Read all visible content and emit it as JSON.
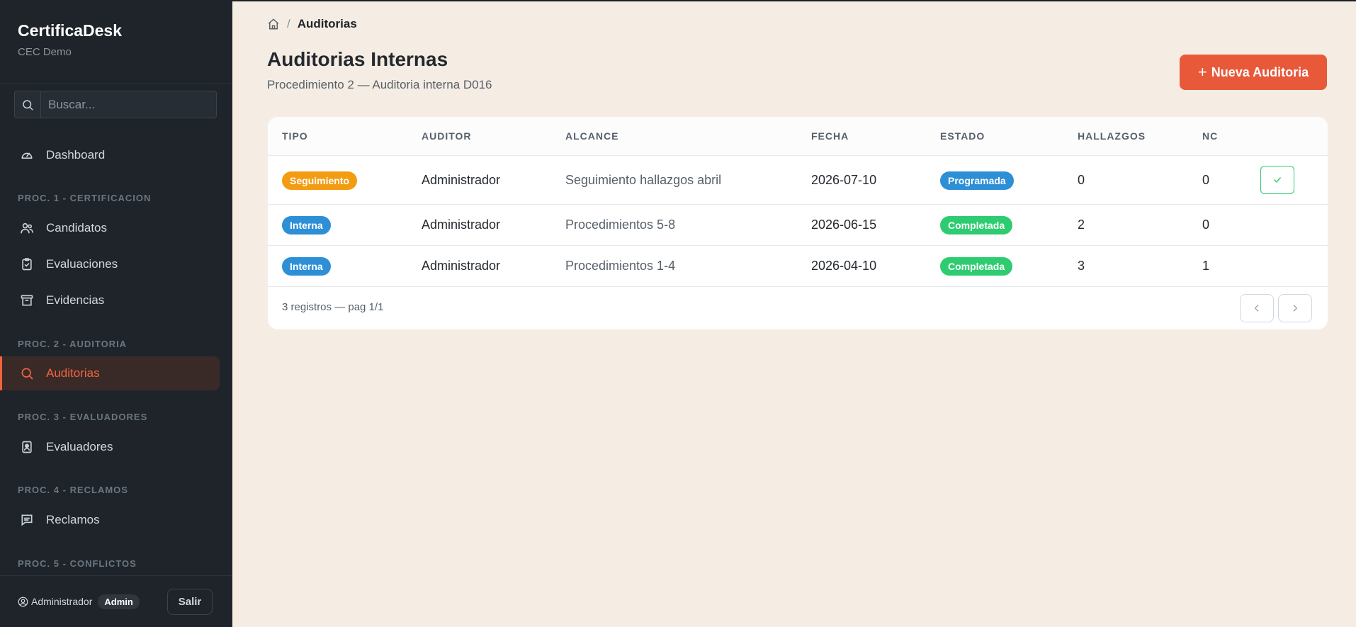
{
  "sidebar": {
    "brand": "CertificaDesk",
    "org": "CEC Demo",
    "search_placeholder": "Buscar...",
    "items": [
      {
        "label": "Dashboard"
      },
      {
        "label": "Candidatos"
      },
      {
        "label": "Evaluaciones"
      },
      {
        "label": "Evidencias"
      },
      {
        "label": "Auditorias"
      },
      {
        "label": "Evaluadores"
      },
      {
        "label": "Reclamos"
      }
    ],
    "sections": [
      "PROC. 1 - CERTIFICACION",
      "PROC. 2 - AUDITORIA",
      "PROC. 3 - EVALUADORES",
      "PROC. 4 - RECLAMOS",
      "PROC. 5 - CONFLICTOS"
    ],
    "user_name": "Administrador",
    "user_role": "Admin",
    "logout_label": "Salir"
  },
  "breadcrumb": {
    "separator": "/",
    "current": "Auditorias"
  },
  "page": {
    "title": "Auditorias Internas",
    "subtitle": "Procedimiento 2 — Auditoria interna D016",
    "new_button": "Nueva Auditoria"
  },
  "table": {
    "headers": [
      "TIPO",
      "AUDITOR",
      "ALCANCE",
      "FECHA",
      "ESTADO",
      "HALLAZGOS",
      "NC"
    ],
    "rows": [
      {
        "tipo": "Seguimiento",
        "auditor": "Administrador",
        "alcance": "Seguimiento hallazgos abril",
        "fecha": "2026-07-10",
        "estado": "Programada",
        "hallazgos": "0",
        "nc": "0"
      },
      {
        "tipo": "Interna",
        "auditor": "Administrador",
        "alcance": "Procedimientos 5-8",
        "fecha": "2026-06-15",
        "estado": "Completada",
        "hallazgos": "2",
        "nc": "0"
      },
      {
        "tipo": "Interna",
        "auditor": "Administrador",
        "alcance": "Procedimientos 1-4",
        "fecha": "2026-04-10",
        "estado": "Completada",
        "hallazgos": "3",
        "nc": "1"
      }
    ],
    "footer": "3 registros — pag 1/1"
  },
  "colors": {
    "accent": "#e8593a",
    "sidebar_bg": "#1e242a",
    "page_bg": "#f5ede3",
    "badge_seguimiento": "#f39c12",
    "badge_interna": "#2d8fd6",
    "badge_programada": "#2d8fd6",
    "badge_completada": "#2ecc71"
  },
  "icons": {
    "search": "search-icon",
    "dashboard": "gauge-icon",
    "candidatos": "users-icon",
    "evaluaciones": "clipboard-icon",
    "evidencias": "archive-icon",
    "auditorias": "search-icon",
    "evaluadores": "id-badge-icon",
    "reclamos": "message-icon",
    "home": "home-icon",
    "user": "user-circle-icon",
    "check": "check-icon",
    "prev": "chevron-left-icon",
    "next": "chevron-right-icon"
  }
}
